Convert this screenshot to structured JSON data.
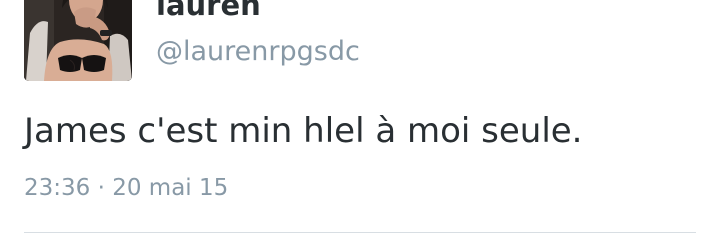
{
  "tweet": {
    "display_name": "lauren",
    "handle": "@laurenrpgsdc",
    "text": "James c'est min hlel à moi seule.",
    "time": "23:36",
    "separator": "·",
    "date": "20 mai 15",
    "avatar_icon": "user-photo-avatar"
  }
}
